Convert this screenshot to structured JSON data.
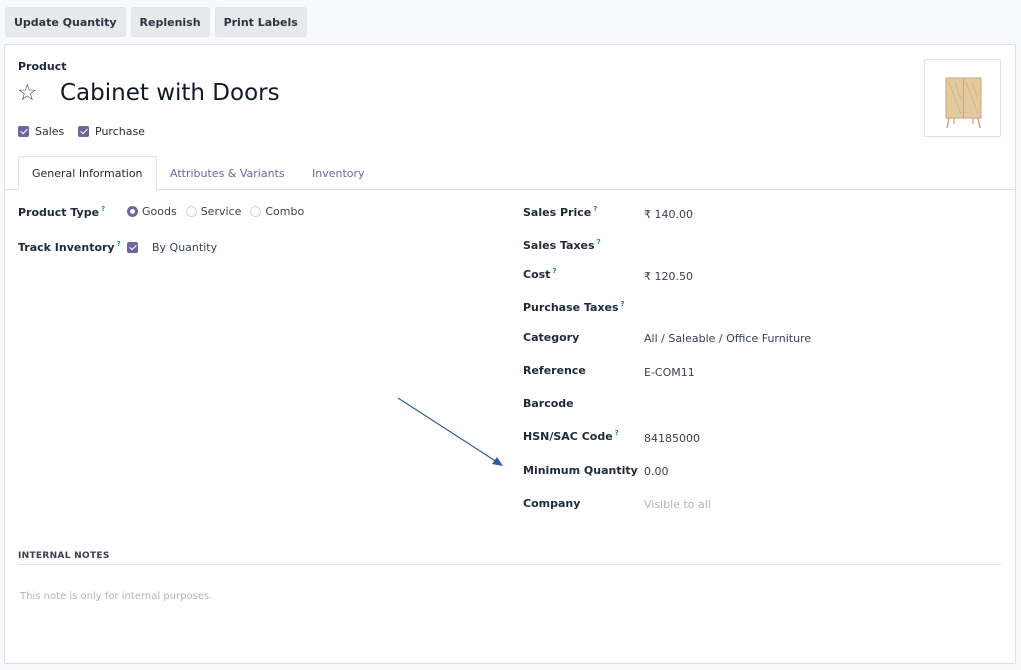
{
  "actions": {
    "update_quantity": "Update Quantity",
    "replenish": "Replenish",
    "print_labels": "Print Labels"
  },
  "product": {
    "kind_label": "Product",
    "name": "Cabinet with Doors",
    "image_icon": "cabinet-image",
    "favorite_icon": "star-outline-icon"
  },
  "flags": {
    "sales": {
      "label": "Sales",
      "checked": true
    },
    "purchase": {
      "label": "Purchase",
      "checked": true
    }
  },
  "tabs": [
    {
      "label": "General Information",
      "active": true
    },
    {
      "label": "Attributes & Variants",
      "active": false
    },
    {
      "label": "Inventory",
      "active": false
    }
  ],
  "left_fields": {
    "product_type": {
      "label": "Product Type",
      "options": [
        {
          "label": "Goods",
          "checked": true
        },
        {
          "label": "Service",
          "checked": false
        },
        {
          "label": "Combo",
          "checked": false
        }
      ]
    },
    "track_inventory": {
      "label": "Track Inventory",
      "value_label": "By Quantity",
      "checked": true
    }
  },
  "right_fields": {
    "sales_price": {
      "label": "Sales Price",
      "value": "₹ 140.00"
    },
    "sales_taxes": {
      "label": "Sales Taxes",
      "value": ""
    },
    "cost": {
      "label": "Cost",
      "value": "₹ 120.50"
    },
    "purchase_taxes": {
      "label": "Purchase Taxes",
      "value": ""
    },
    "category": {
      "label": "Category",
      "value": "All / Saleable / Office Furniture"
    },
    "reference": {
      "label": "Reference",
      "value": "E-COM11"
    },
    "barcode": {
      "label": "Barcode",
      "value": ""
    },
    "hsn_sac": {
      "label": "HSN/SAC Code",
      "value": "84185000"
    },
    "min_qty": {
      "label": "Minimum Quantity",
      "value": "0.00"
    },
    "company": {
      "label": "Company",
      "placeholder": "Visible to all"
    }
  },
  "help_marker": "?",
  "internal_notes": {
    "heading": "INTERNAL NOTES",
    "placeholder": "This note is only for internal purposes."
  },
  "colors": {
    "accent": "#71639e",
    "annotation_arrow": "#2f5d9a",
    "help": "#0f7ac8"
  }
}
